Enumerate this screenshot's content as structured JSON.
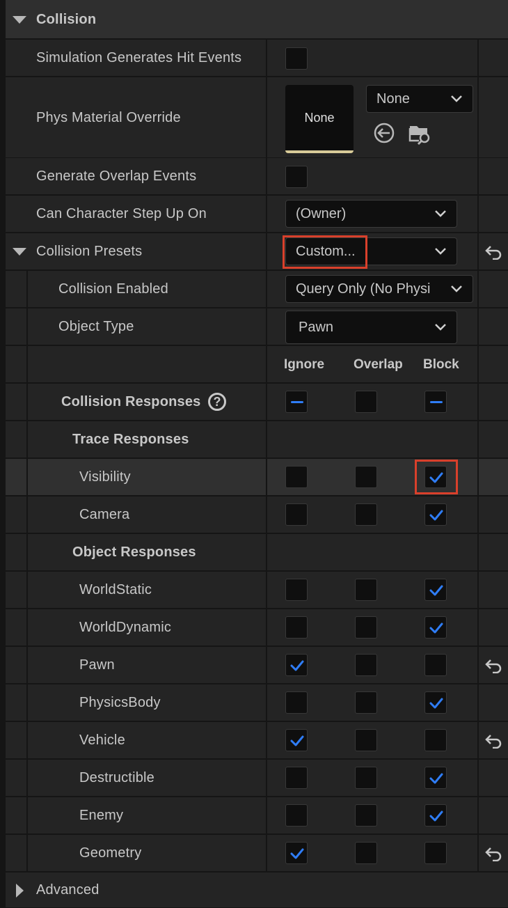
{
  "section": {
    "title": "Collision"
  },
  "props": {
    "sim_hit": "Simulation Generates Hit Events",
    "phys_mat": "Phys Material Override",
    "phys_mat_thumb": "None",
    "phys_mat_select": "None",
    "gen_overlap": "Generate Overlap Events",
    "step_up": "Can Character Step Up On",
    "step_up_value": "(Owner)",
    "presets": "Collision Presets",
    "presets_value": "Custom...",
    "enabled": "Collision Enabled",
    "enabled_value": "Query Only (No Physi",
    "object_type": "Object Type",
    "object_type_value": "Pawn"
  },
  "columns": {
    "ignore": "Ignore",
    "overlap": "Overlap",
    "block": "Block"
  },
  "responses": {
    "title": "Collision Responses",
    "help": "?",
    "trace_title": "Trace Responses",
    "object_title": "Object Responses",
    "trace": [
      {
        "name": "Visibility",
        "ignore": false,
        "overlap": false,
        "block": true
      },
      {
        "name": "Camera",
        "ignore": false,
        "overlap": false,
        "block": true
      }
    ],
    "object": [
      {
        "name": "WorldStatic",
        "ignore": false,
        "overlap": false,
        "block": true
      },
      {
        "name": "WorldDynamic",
        "ignore": false,
        "overlap": false,
        "block": true
      },
      {
        "name": "Pawn",
        "ignore": true,
        "overlap": false,
        "block": false
      },
      {
        "name": "PhysicsBody",
        "ignore": false,
        "overlap": false,
        "block": true
      },
      {
        "name": "Vehicle",
        "ignore": true,
        "overlap": false,
        "block": false
      },
      {
        "name": "Destructible",
        "ignore": false,
        "overlap": false,
        "block": true
      },
      {
        "name": "Enemy",
        "ignore": false,
        "overlap": false,
        "block": true
      },
      {
        "name": "Geometry",
        "ignore": true,
        "overlap": false,
        "block": false
      }
    ]
  },
  "advanced": {
    "title": "Advanced"
  },
  "colors": {
    "accent": "#2f7df6",
    "highlight": "#d9402b"
  }
}
